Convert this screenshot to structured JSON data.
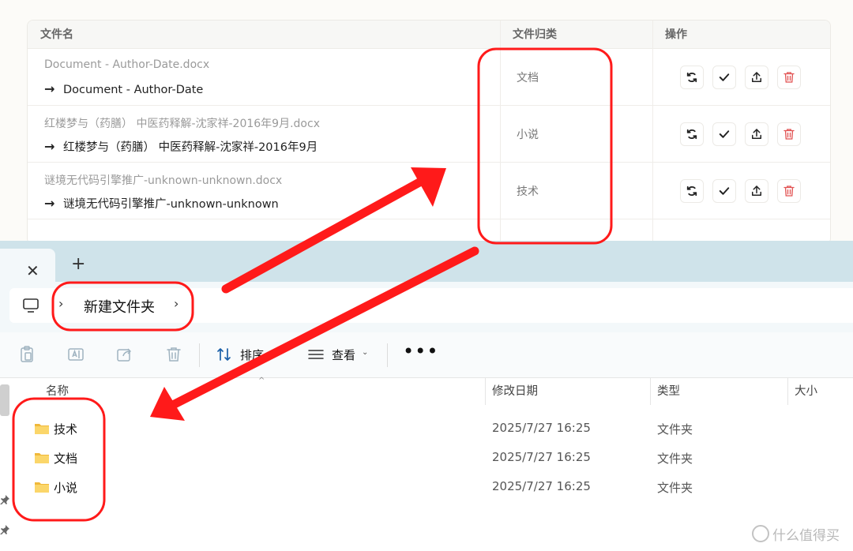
{
  "table": {
    "headers": {
      "filename": "文件名",
      "category": "文件归类",
      "actions": "操作"
    },
    "rows": [
      {
        "original": "Document - Author-Date.docx",
        "arrow": "→",
        "renamed": "Document - Author-Date",
        "category": "文档"
      },
      {
        "original": "红楼梦与（药膳） 中医药释解-沈家祥-2016年9月.docx",
        "arrow": "→",
        "renamed": "红楼梦与（药膳） 中医药释解-沈家祥-2016年9月",
        "category": "小说"
      },
      {
        "original": "谜境无代码引擎推广-unknown-unknown.docx",
        "arrow": "→",
        "renamed": "谜境无代码引擎推广-unknown-unknown",
        "category": "技术"
      }
    ],
    "action_icons": [
      "refresh-icon",
      "check-icon",
      "upload-icon",
      "trash-icon"
    ],
    "colors": {
      "trash": "#e25555"
    }
  },
  "explorer": {
    "tab_close": "✕",
    "new_tab": "+",
    "breadcrumb": {
      "separator_1": "›",
      "folder": "新建文件夹",
      "separator_2": "›"
    },
    "toolbar": {
      "sort_label": "排序",
      "view_label": "查看",
      "more": "•••",
      "caret": "⌄"
    },
    "columns": {
      "name": "名称",
      "modified": "修改日期",
      "type": "类型",
      "size": "大小"
    },
    "sort_indicator": "^",
    "folders": [
      {
        "name": "技术",
        "modified": "2025/7/27 16:25",
        "type": "文件夹"
      },
      {
        "name": "文档",
        "modified": "2025/7/27 16:25",
        "type": "文件夹"
      },
      {
        "name": "小说",
        "modified": "2025/7/27 16:25",
        "type": "文件夹"
      }
    ]
  },
  "annotations": {
    "color": "#ff1a1a"
  },
  "watermark": {
    "text": "什么值得买"
  }
}
